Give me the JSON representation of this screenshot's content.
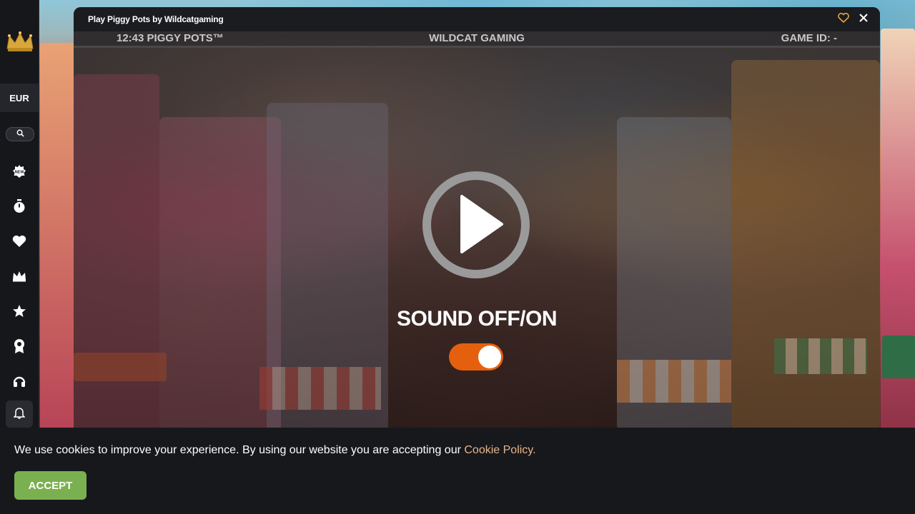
{
  "sidebar": {
    "currency": "EUR",
    "icons": [
      "new-badge-icon",
      "stopwatch-icon",
      "heart-icon",
      "crown-icon",
      "star-icon",
      "award-icon",
      "headset-icon",
      "bell-icon"
    ]
  },
  "modal": {
    "title": "Play Piggy Pots by Wildcatgaming"
  },
  "game": {
    "hud_left": "12:43 PIGGY POTS™",
    "hud_center": "WILDCAT GAMING",
    "hud_right": "GAME ID: -",
    "sound_label": "SOUND OFF/ON",
    "sound_on": true
  },
  "cookie": {
    "text": "We use cookies to improve your experience. By using our website you are accepting our ",
    "link": "Cookie Policy.",
    "accept_label": "ACCEPT"
  },
  "colors": {
    "accent_orange": "#e5600e",
    "accept_green": "#7ab04f",
    "link": "#e8b48a",
    "crown_gold": "#d8a63a"
  }
}
